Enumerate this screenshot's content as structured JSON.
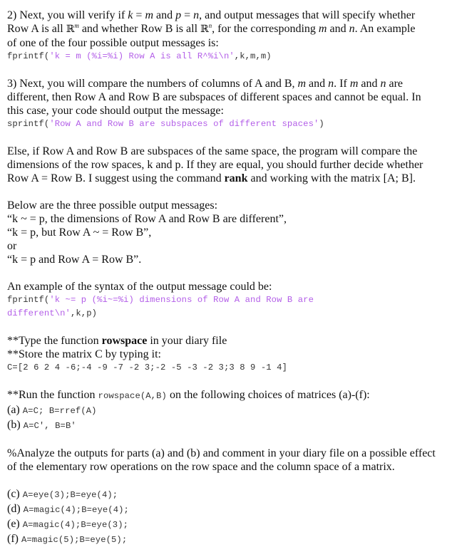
{
  "section2": {
    "line1_a": "2) Next, you will verify if ",
    "k": "k",
    "eq": " = ",
    "m": "m",
    "and": " and ",
    "p": "p",
    "n": "n",
    "line1_b": ", and output messages that will specify whether",
    "line2_a": "Row A is all ",
    "R": "ℝ",
    "line2_b": " and whether Row B is all ",
    "line2_c": ", for the corresponding ",
    "line2_d": ". An example",
    "line3": "of one of the four possible output messages is:",
    "code_fn": "fprintf(",
    "code_str": "'k = m (%i=%i) Row A is all R^%i\\n'",
    "code_args": ",k,m,m)"
  },
  "section3": {
    "line1_a": "3) Next, you will compare the numbers of columns of A and B, ",
    "line1_b": ". If ",
    "line1_c": " are",
    "line2": "different, then Row A and Row B are subspaces of different spaces and cannot be equal. In",
    "line3": "this case, your code should output the message:",
    "code_fn": "sprintf(",
    "code_str": "'Row A and Row B are subspaces of different spaces'",
    "code_args": ")"
  },
  "else_para": {
    "line1": "Else, if Row A and Row B are subspaces of the same space, the program will compare the",
    "line2": "dimensions of the row spaces, k and p. If they are equal, you should further decide whether",
    "line3_a": "Row A = Row B. I suggest using the command ",
    "line3_bold": "rank",
    "line3_b": " and working with the matrix [A; B]."
  },
  "messages": {
    "intro": "Below are the three possible output messages:",
    "items": [
      "“k ~ = p, the dimensions of Row A and Row B are different”,",
      "“k = p, but Row A ~ = Row B”,",
      "or",
      "“k = p and Row A = Row B”."
    ]
  },
  "example": {
    "intro": "An example of the syntax of the output message could be:",
    "code_fn": "fprintf(",
    "code_str1": "'k ~= p (%i~=%i) dimensions of Row A and Row B are",
    "code_str2": "different\\n'",
    "code_args": ",k,p)"
  },
  "instructions": {
    "type_a": "**Type the function ",
    "type_bold": "rowspace",
    "type_b": " in your diary file",
    "store": "**Store the matrix C by typing it:",
    "matrix_code": "C=[2 6 2 4 -6;-4 -9 -7 -2 3;-2 -5 -3 -2 3;3 8 9 -1 4]"
  },
  "run": {
    "intro_a": "**Run the function ",
    "intro_code": "rowspace(A,B)",
    "intro_b": " on the following choices of matrices (a)-(f):",
    "parts_ab": [
      {
        "label": "(a) ",
        "code": "A=C; B=rref(A)"
      },
      {
        "label": "(b) ",
        "code": "A=C', B=B'"
      }
    ]
  },
  "analyze": {
    "line1": "%Analyze the outputs for parts (a) and (b) and comment in your diary file on a possible effect",
    "line2": "of the elementary row operations on the row space and the column space of a matrix."
  },
  "parts_cf": [
    {
      "label": "(c) ",
      "code": "A=eye(3);B=eye(4);"
    },
    {
      "label": "(d) ",
      "code": "A=magic(4);B=eye(4);"
    },
    {
      "label": "(e) ",
      "code": "A=magic(4);B=eye(3);"
    },
    {
      "label": "(f) ",
      "code": "A=magic(5);B=eye(5);"
    }
  ]
}
